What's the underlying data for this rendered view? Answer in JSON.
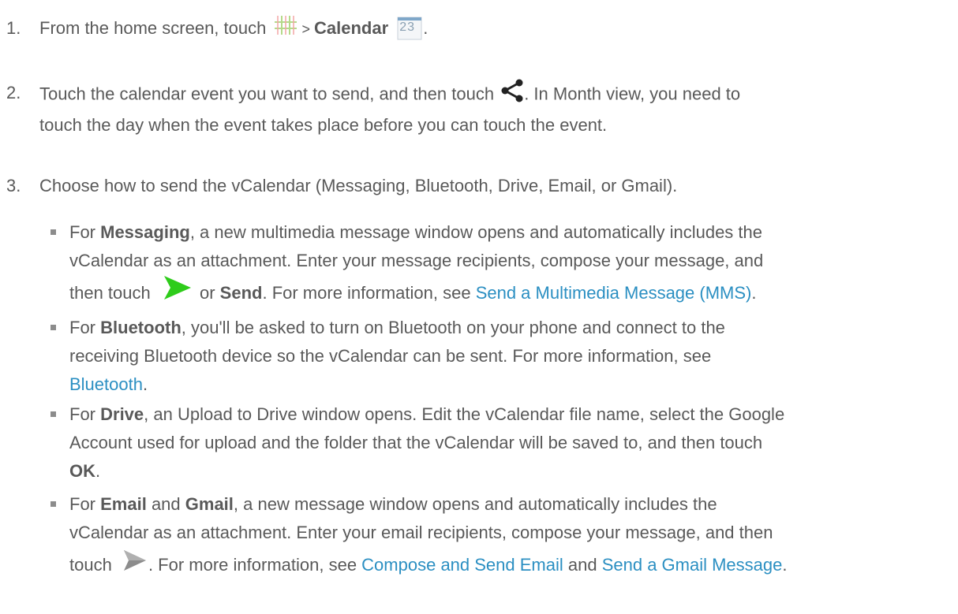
{
  "steps": [
    {
      "num": "1.",
      "t1": "From the home screen, touch",
      "t2": " > ",
      "bold1": "Calendar",
      "cal_day": "23",
      "t3": "."
    },
    {
      "num": "2.",
      "t1": "Touch the calendar event you want to send, and then touch",
      "t2": ". In Month view, you need to",
      "t3": "touch the day when the event takes place before you can touch the event."
    },
    {
      "num": "3.",
      "t1": "Choose how to send the vCalendar (Messaging, Bluetooth, Drive, Email, or Gmail)."
    }
  ],
  "bullets": {
    "messaging": {
      "t0": "For ",
      "b1": "Messaging",
      "t1": ", a new multimedia message window opens and automatically includes the",
      "t2": "vCalendar as an attachment. Enter your message recipients, compose your message, and",
      "t3": "then touch",
      "t4": " or ",
      "b2": "Send",
      "t5": ". For more information, see ",
      "link": "Send a Multimedia Message (MMS)",
      "t6": "."
    },
    "bluetooth": {
      "t0": "For ",
      "b1": "Bluetooth",
      "t1": ", you'll be asked to turn on Bluetooth on your phone and connect to the",
      "t2": "receiving Bluetooth device so the vCalendar can be sent. For more information, see",
      "link": "Bluetooth",
      "t3": "."
    },
    "drive": {
      "t0": "For ",
      "b1": "Drive",
      "t1": ", an Upload to Drive window opens. Edit the vCalendar file name, select the Google",
      "t2": "Account used for upload and the folder that the vCalendar will be saved to, and then touch",
      "b2": "OK",
      "t3": "."
    },
    "email": {
      "t0": "For ",
      "b1": "Email",
      "t1": " and ",
      "b2": "Gmail",
      "t2": ", a new message window opens and automatically includes the",
      "t3": "vCalendar as an attachment. Enter your email recipients, compose your message, and then",
      "t4": "touch",
      "t5": ". For more information, see ",
      "link1": "Compose and Send Email",
      "t6": " and ",
      "link2": "Send a Gmail Message",
      "t7": "."
    }
  },
  "icons": {
    "apps": "apps-grid-icon",
    "calendar": "calendar-icon",
    "share": "share-icon",
    "send_green": "send-arrow-green-icon",
    "send_gray": "send-arrow-gray-icon"
  },
  "colors": {
    "text": "#595959",
    "link": "#2b8fc2",
    "send_green": "#2ecc1a"
  }
}
